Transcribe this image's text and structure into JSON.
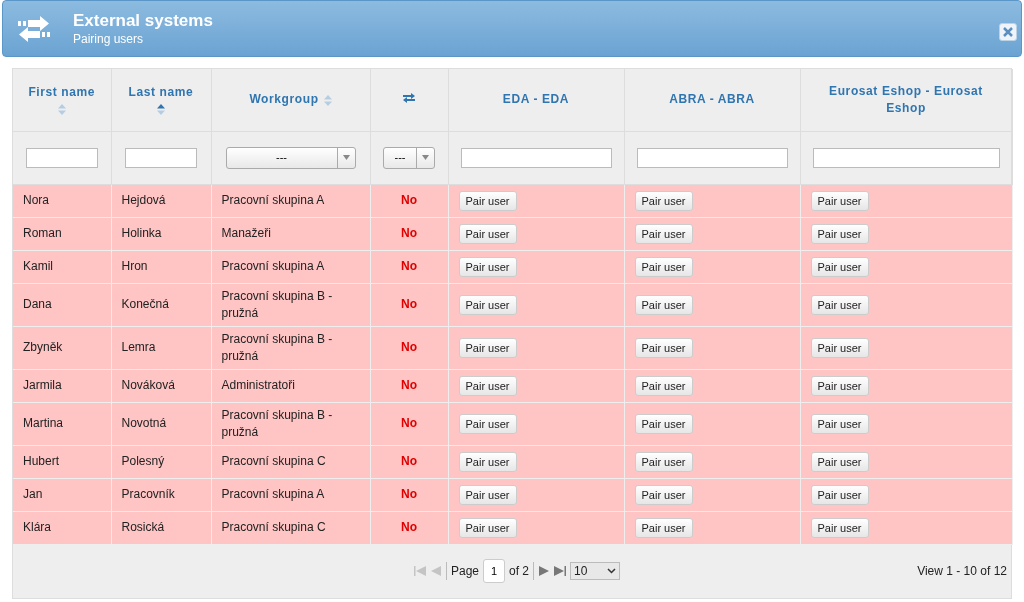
{
  "window": {
    "title": "External systems",
    "subtitle": "Pairing users"
  },
  "table": {
    "columns": [
      {
        "kind": "text",
        "label": "First name",
        "sorted": false
      },
      {
        "kind": "text",
        "label": "Last name",
        "sorted": true
      },
      {
        "kind": "text",
        "label": "Workgroup",
        "sorted": false
      },
      {
        "kind": "icon"
      },
      {
        "kind": "text",
        "label": "EDA - EDA"
      },
      {
        "kind": "text",
        "label": "ABRA - ABRA"
      },
      {
        "kind": "text",
        "label": "Eurosat Eshop - Eurosat Eshop"
      }
    ],
    "filters": [
      {
        "kind": "text"
      },
      {
        "kind": "text"
      },
      {
        "kind": "select",
        "value": "---"
      },
      {
        "kind": "select",
        "value": "---"
      },
      {
        "kind": "text"
      },
      {
        "kind": "text"
      },
      {
        "kind": "text"
      }
    ],
    "rows": [
      {
        "first_name": "Nora",
        "last_name": "Hejdová",
        "workgroup": "Pracovní skupina A",
        "paired": false,
        "paired_label": "No",
        "actions": [
          "Pair user",
          "Pair user",
          "Pair user"
        ]
      },
      {
        "first_name": "Roman",
        "last_name": "Holinka",
        "workgroup": "Manažeři",
        "paired": false,
        "paired_label": "No",
        "actions": [
          "Pair user",
          "Pair user",
          "Pair user"
        ]
      },
      {
        "first_name": "Kamil",
        "last_name": "Hron",
        "workgroup": "Pracovní skupina A",
        "paired": false,
        "paired_label": "No",
        "actions": [
          "Pair user",
          "Pair user",
          "Pair user"
        ]
      },
      {
        "first_name": "Dana",
        "last_name": "Konečná",
        "workgroup": "Pracovní skupina B - pružná",
        "paired": false,
        "paired_label": "No",
        "actions": [
          "Pair user",
          "Pair user",
          "Pair user"
        ]
      },
      {
        "first_name": "Zbyněk",
        "last_name": "Lemra",
        "workgroup": "Pracovní skupina B - pružná",
        "paired": false,
        "paired_label": "No",
        "actions": [
          "Pair user",
          "Pair user",
          "Pair user"
        ]
      },
      {
        "first_name": "Jarmila",
        "last_name": "Nováková",
        "workgroup": "Administratoři",
        "paired": false,
        "paired_label": "No",
        "actions": [
          "Pair user",
          "Pair user",
          "Pair user"
        ]
      },
      {
        "first_name": "Martina",
        "last_name": "Novotná",
        "workgroup": "Pracovní skupina B - pružná",
        "paired": false,
        "paired_label": "No",
        "actions": [
          "Pair user",
          "Pair user",
          "Pair user"
        ]
      },
      {
        "first_name": "Hubert",
        "last_name": "Polesný",
        "workgroup": "Pracovní skupina C",
        "paired": false,
        "paired_label": "No",
        "actions": [
          "Pair user",
          "Pair user",
          "Pair user"
        ]
      },
      {
        "first_name": "Jan",
        "last_name": "Pracovník",
        "workgroup": "Pracovní skupina A",
        "paired": false,
        "paired_label": "No",
        "actions": [
          "Pair user",
          "Pair user",
          "Pair user"
        ]
      },
      {
        "first_name": "Klára",
        "last_name": "Rosická",
        "workgroup": "Pracovní skupina C",
        "paired": false,
        "paired_label": "No",
        "actions": [
          "Pair user",
          "Pair user",
          "Pair user"
        ]
      }
    ]
  },
  "pager": {
    "nav": [
      {
        "kind": "first",
        "disabled": true
      },
      {
        "kind": "prev",
        "disabled": true
      },
      {
        "kind": "next",
        "disabled": false
      },
      {
        "kind": "last",
        "disabled": false
      }
    ],
    "page_label": "Page",
    "page": "1",
    "of_label": "of 2",
    "page_size": "10",
    "summary": "View 1 - 10 of 12"
  }
}
